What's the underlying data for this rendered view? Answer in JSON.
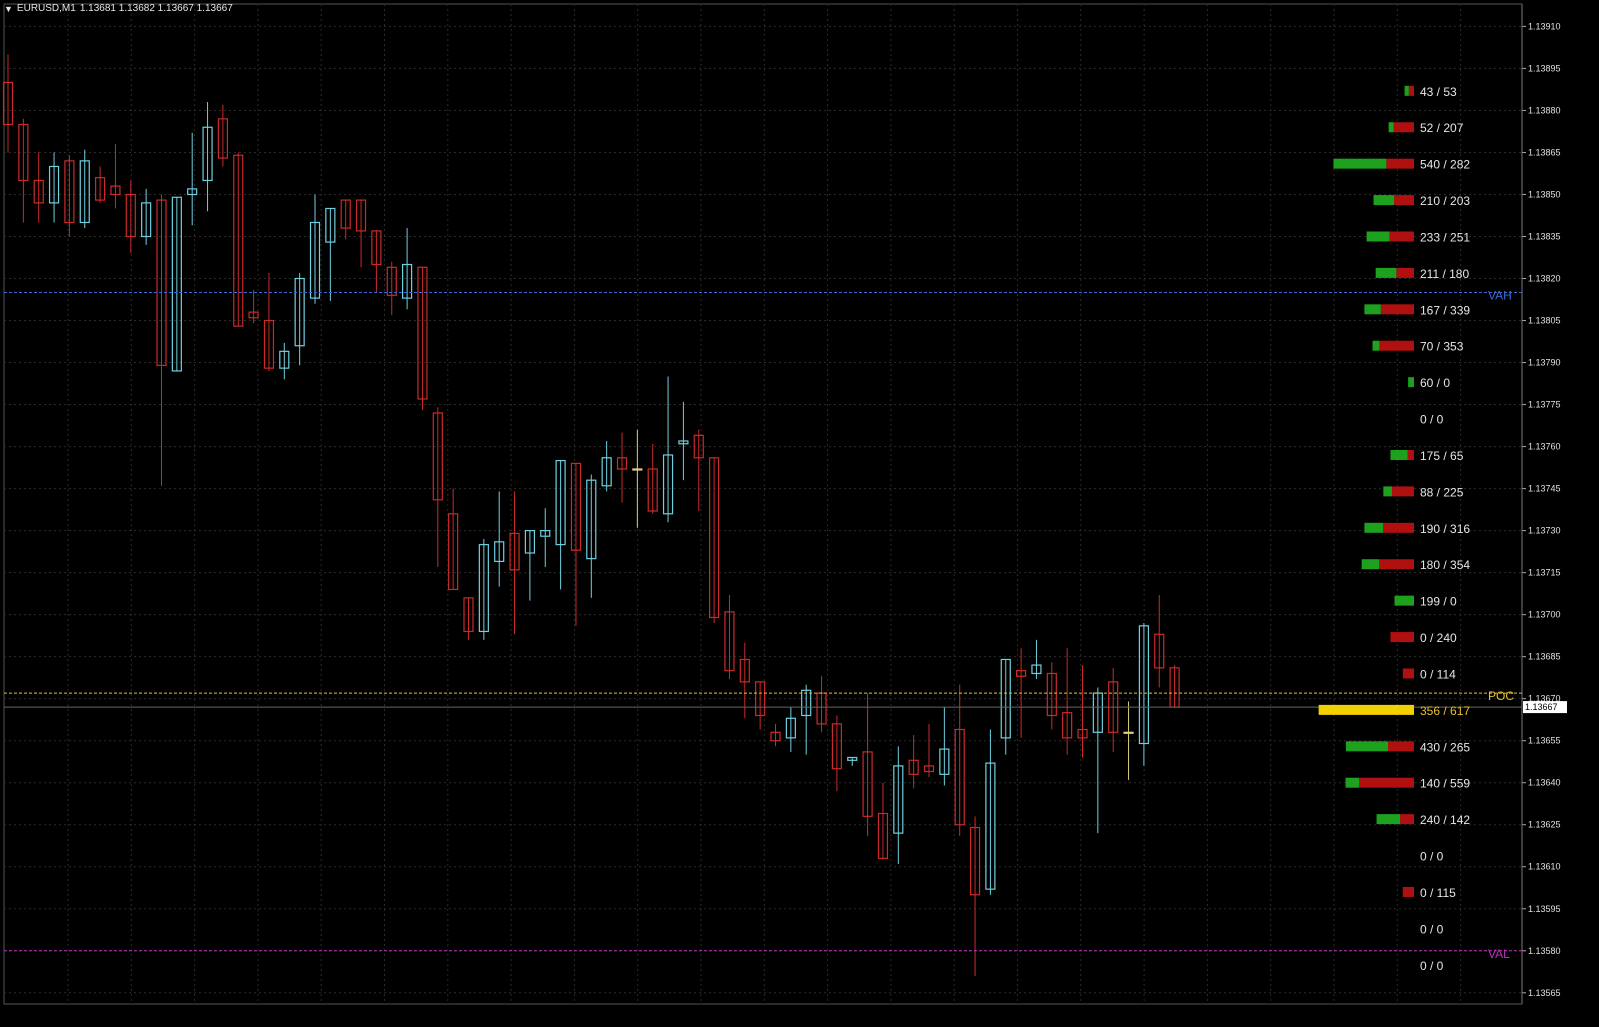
{
  "header": {
    "menu_icon": "triangle-down-icon",
    "symbol": "EURUSD,M1",
    "ohlc": "1.13681 1.13682 1.13667 1.13667"
  },
  "colors": {
    "background": "#000000",
    "grid": "#2b2b2b",
    "bull": "#6fd0e0",
    "bear": "#cc2a2a",
    "doji": "#d8d27a",
    "vah": "#3a6ad8",
    "poc": "#e8c030",
    "val": "#c030c0",
    "buy_bar": "#1ea11e",
    "sell_bar": "#b01010",
    "poc_bar": "#f2d100",
    "axis_text": "#e0e0e0",
    "profile_text": "#e6e6e6"
  },
  "axis": {
    "ticks": [
      "1.13910",
      "1.13895",
      "1.13880",
      "1.13865",
      "1.13850",
      "1.13835",
      "1.13820",
      "1.13805",
      "1.13790",
      "1.13775",
      "1.13760",
      "1.13745",
      "1.13730",
      "1.13715",
      "1.13700",
      "1.13685",
      "1.13670",
      "1.13655",
      "1.13640",
      "1.13625",
      "1.13610",
      "1.13595",
      "1.13580",
      "1.13565"
    ],
    "current_price": "1.13667"
  },
  "chart_data": {
    "type": "candlestick",
    "symbol": "EURUSD",
    "timeframe": "M1",
    "ylim": [
      1.13561,
      1.13918
    ],
    "grid": true,
    "candles": [
      {
        "o": 1.1389,
        "h": 1.139,
        "l": 1.13865,
        "c": 1.13875
      },
      {
        "o": 1.13875,
        "h": 1.13877,
        "l": 1.1384,
        "c": 1.13855
      },
      {
        "o": 1.13855,
        "h": 1.13865,
        "l": 1.1384,
        "c": 1.13847
      },
      {
        "o": 1.13847,
        "h": 1.13865,
        "l": 1.1384,
        "c": 1.1386
      },
      {
        "o": 1.13862,
        "h": 1.13864,
        "l": 1.13835,
        "c": 1.1384
      },
      {
        "o": 1.1384,
        "h": 1.13866,
        "l": 1.13838,
        "c": 1.13862
      },
      {
        "o": 1.13856,
        "h": 1.1386,
        "l": 1.13847,
        "c": 1.13848
      },
      {
        "o": 1.13853,
        "h": 1.13868,
        "l": 1.13845,
        "c": 1.1385
      },
      {
        "o": 1.1385,
        "h": 1.13855,
        "l": 1.13829,
        "c": 1.13835
      },
      {
        "o": 1.13835,
        "h": 1.13852,
        "l": 1.13832,
        "c": 1.13847
      },
      {
        "o": 1.13848,
        "h": 1.1385,
        "l": 1.13746,
        "c": 1.13789
      },
      {
        "o": 1.13787,
        "h": 1.13788,
        "l": 1.13787,
        "c": 1.13849
      },
      {
        "o": 1.1385,
        "h": 1.13872,
        "l": 1.13839,
        "c": 1.13852
      },
      {
        "o": 1.13855,
        "h": 1.13883,
        "l": 1.13844,
        "c": 1.13874
      },
      {
        "o": 1.13877,
        "h": 1.13882,
        "l": 1.1386,
        "c": 1.13863
      },
      {
        "o": 1.13864,
        "h": 1.13865,
        "l": 1.13803,
        "c": 1.13803
      },
      {
        "o": 1.13808,
        "h": 1.13816,
        "l": 1.13804,
        "c": 1.13806
      },
      {
        "o": 1.13805,
        "h": 1.13822,
        "l": 1.13787,
        "c": 1.13788
      },
      {
        "o": 1.13788,
        "h": 1.13797,
        "l": 1.13784,
        "c": 1.13794
      },
      {
        "o": 1.13796,
        "h": 1.13822,
        "l": 1.13789,
        "c": 1.1382
      },
      {
        "o": 1.13813,
        "h": 1.1385,
        "l": 1.13811,
        "c": 1.1384
      },
      {
        "o": 1.13833,
        "h": 1.13845,
        "l": 1.13812,
        "c": 1.13845
      },
      {
        "o": 1.13848,
        "h": 1.13848,
        "l": 1.13834,
        "c": 1.13838
      },
      {
        "o": 1.13848,
        "h": 1.13848,
        "l": 1.13824,
        "c": 1.13837
      },
      {
        "o": 1.13837,
        "h": 1.13835,
        "l": 1.13815,
        "c": 1.13825
      },
      {
        "o": 1.13824,
        "h": 1.13826,
        "l": 1.13807,
        "c": 1.13814
      },
      {
        "o": 1.13813,
        "h": 1.13838,
        "l": 1.13809,
        "c": 1.13825
      },
      {
        "o": 1.13824,
        "h": 1.13824,
        "l": 1.13773,
        "c": 1.13777
      },
      {
        "o": 1.13772,
        "h": 1.13774,
        "l": 1.13717,
        "c": 1.13741
      },
      {
        "o": 1.13736,
        "h": 1.13745,
        "l": 1.13723,
        "c": 1.13709
      },
      {
        "o": 1.13706,
        "h": 1.13697,
        "l": 1.13691,
        "c": 1.13694
      },
      {
        "o": 1.13694,
        "h": 1.13727,
        "l": 1.13691,
        "c": 1.13725
      },
      {
        "o": 1.13719,
        "h": 1.13744,
        "l": 1.1371,
        "c": 1.13726
      },
      {
        "o": 1.13729,
        "h": 1.13744,
        "l": 1.13693,
        "c": 1.13716
      },
      {
        "o": 1.13722,
        "h": 1.13724,
        "l": 1.13705,
        "c": 1.1373
      },
      {
        "o": 1.13728,
        "h": 1.13738,
        "l": 1.13717,
        "c": 1.1373
      },
      {
        "o": 1.13725,
        "h": 1.13755,
        "l": 1.13709,
        "c": 1.13755
      },
      {
        "o": 1.13754,
        "h": 1.13753,
        "l": 1.13696,
        "c": 1.13723
      },
      {
        "o": 1.1372,
        "h": 1.1375,
        "l": 1.13706,
        "c": 1.13748
      },
      {
        "o": 1.13746,
        "h": 1.13762,
        "l": 1.13744,
        "c": 1.13756
      },
      {
        "o": 1.13756,
        "h": 1.13765,
        "l": 1.1374,
        "c": 1.13752
      },
      {
        "o": 1.13752,
        "h": 1.13766,
        "l": 1.13731,
        "c": 1.13752
      },
      {
        "o": 1.13752,
        "h": 1.13761,
        "l": 1.13736,
        "c": 1.13737
      },
      {
        "o": 1.13736,
        "h": 1.13785,
        "l": 1.13733,
        "c": 1.13757
      },
      {
        "o": 1.13761,
        "h": 1.13776,
        "l": 1.13748,
        "c": 1.13762
      },
      {
        "o": 1.13764,
        "h": 1.13766,
        "l": 1.13737,
        "c": 1.13756
      },
      {
        "o": 1.13756,
        "h": 1.13755,
        "l": 1.13697,
        "c": 1.13699
      },
      {
        "o": 1.13701,
        "h": 1.13707,
        "l": 1.13677,
        "c": 1.1368
      },
      {
        "o": 1.13684,
        "h": 1.1369,
        "l": 1.13663,
        "c": 1.13676
      },
      {
        "o": 1.13676,
        "h": 1.13674,
        "l": 1.13659,
        "c": 1.13664
      },
      {
        "o": 1.13658,
        "h": 1.13661,
        "l": 1.13653,
        "c": 1.13655
      },
      {
        "o": 1.13656,
        "h": 1.13667,
        "l": 1.13651,
        "c": 1.13663
      },
      {
        "o": 1.13664,
        "h": 1.13675,
        "l": 1.1365,
        "c": 1.13673
      },
      {
        "o": 1.13672,
        "h": 1.13678,
        "l": 1.13658,
        "c": 1.13661
      },
      {
        "o": 1.13661,
        "h": 1.13664,
        "l": 1.13637,
        "c": 1.13645
      },
      {
        "o": 1.13648,
        "h": 1.13645,
        "l": 1.13646,
        "c": 1.13649
      },
      {
        "o": 1.13651,
        "h": 1.13672,
        "l": 1.13621,
        "c": 1.13628
      },
      {
        "o": 1.13629,
        "h": 1.1364,
        "l": 1.13617,
        "c": 1.13613
      },
      {
        "o": 1.13622,
        "h": 1.13653,
        "l": 1.13611,
        "c": 1.13646
      },
      {
        "o": 1.13648,
        "h": 1.13657,
        "l": 1.13638,
        "c": 1.13643
      },
      {
        "o": 1.13646,
        "h": 1.13661,
        "l": 1.13642,
        "c": 1.13644
      },
      {
        "o": 1.13643,
        "h": 1.13667,
        "l": 1.13639,
        "c": 1.13652
      },
      {
        "o": 1.13659,
        "h": 1.13675,
        "l": 1.13621,
        "c": 1.13625
      },
      {
        "o": 1.13624,
        "h": 1.13628,
        "l": 1.13571,
        "c": 1.136
      },
      {
        "o": 1.13602,
        "h": 1.13659,
        "l": 1.136,
        "c": 1.13647
      },
      {
        "o": 1.13656,
        "h": 1.13683,
        "l": 1.1365,
        "c": 1.13684
      },
      {
        "o": 1.1368,
        "h": 1.13688,
        "l": 1.13656,
        "c": 1.13678
      },
      {
        "o": 1.13679,
        "h": 1.13691,
        "l": 1.13677,
        "c": 1.13682
      },
      {
        "o": 1.13679,
        "h": 1.13683,
        "l": 1.13659,
        "c": 1.13664
      },
      {
        "o": 1.13665,
        "h": 1.13688,
        "l": 1.1365,
        "c": 1.13656
      },
      {
        "o": 1.13659,
        "h": 1.13682,
        "l": 1.13649,
        "c": 1.13656
      },
      {
        "o": 1.13658,
        "h": 1.13674,
        "l": 1.13622,
        "c": 1.13672
      },
      {
        "o": 1.13676,
        "h": 1.13681,
        "l": 1.13651,
        "c": 1.13658
      },
      {
        "o": 1.13658,
        "h": 1.13669,
        "l": 1.13641,
        "c": 1.13658
      },
      {
        "o": 1.13654,
        "h": 1.13697,
        "l": 1.13646,
        "c": 1.13696
      },
      {
        "o": 1.13693,
        "h": 1.13707,
        "l": 1.13674,
        "c": 1.13681
      },
      {
        "o": 1.13681,
        "h": 1.13682,
        "l": 1.13667,
        "c": 1.13667
      }
    ],
    "value_area": {
      "vah": 1.13815,
      "poc": 1.13672,
      "val": 1.1358
    },
    "level_labels": {
      "vah": "VAH",
      "poc": "POC",
      "val": "VAL"
    },
    "volume_profile": [
      {
        "label": "43 / 53",
        "price": 1.13887,
        "buy": 43,
        "sell": 53
      },
      {
        "label": "52 / 207",
        "price": 1.13874,
        "buy": 52,
        "sell": 207
      },
      {
        "label": "540 / 282",
        "price": 1.13861,
        "buy": 540,
        "sell": 282
      },
      {
        "label": "210 / 203",
        "price": 1.13848,
        "buy": 210,
        "sell": 203
      },
      {
        "label": "233 / 251",
        "price": 1.13835,
        "buy": 233,
        "sell": 251
      },
      {
        "label": "211 / 180",
        "price": 1.13822,
        "buy": 211,
        "sell": 180
      },
      {
        "label": "167 / 339",
        "price": 1.13809,
        "buy": 167,
        "sell": 339
      },
      {
        "label": "70 / 353",
        "price": 1.13796,
        "buy": 70,
        "sell": 353
      },
      {
        "label": "60 / 0",
        "price": 1.13783,
        "buy": 60,
        "sell": 0
      },
      {
        "label": "0 / 0",
        "price": 1.1377,
        "buy": 0,
        "sell": 0
      },
      {
        "label": "175 / 65",
        "price": 1.13757,
        "buy": 175,
        "sell": 65
      },
      {
        "label": "88 / 225",
        "price": 1.13744,
        "buy": 88,
        "sell": 225
      },
      {
        "label": "190 / 316",
        "price": 1.13731,
        "buy": 190,
        "sell": 316
      },
      {
        "label": "180 / 354",
        "price": 1.13718,
        "buy": 180,
        "sell": 354
      },
      {
        "label": "199 / 0",
        "price": 1.13705,
        "buy": 199,
        "sell": 0
      },
      {
        "label": "0 / 240",
        "price": 1.13692,
        "buy": 0,
        "sell": 240
      },
      {
        "label": "0 / 114",
        "price": 1.13679,
        "buy": 0,
        "sell": 114
      },
      {
        "label": "356 / 617",
        "price": 1.13666,
        "buy": 356,
        "sell": 617,
        "poc": true
      },
      {
        "label": "430 / 265",
        "price": 1.13653,
        "buy": 430,
        "sell": 265
      },
      {
        "label": "140 / 559",
        "price": 1.1364,
        "buy": 140,
        "sell": 559
      },
      {
        "label": "240 / 142",
        "price": 1.13627,
        "buy": 240,
        "sell": 142
      },
      {
        "label": "0 / 0",
        "price": 1.13614,
        "buy": 0,
        "sell": 0
      },
      {
        "label": "0 / 115",
        "price": 1.13601,
        "buy": 0,
        "sell": 115
      },
      {
        "label": "0 / 0",
        "price": 1.13588,
        "buy": 0,
        "sell": 0
      },
      {
        "label": "0 / 0",
        "price": 1.13575,
        "buy": 0,
        "sell": 0
      }
    ]
  }
}
